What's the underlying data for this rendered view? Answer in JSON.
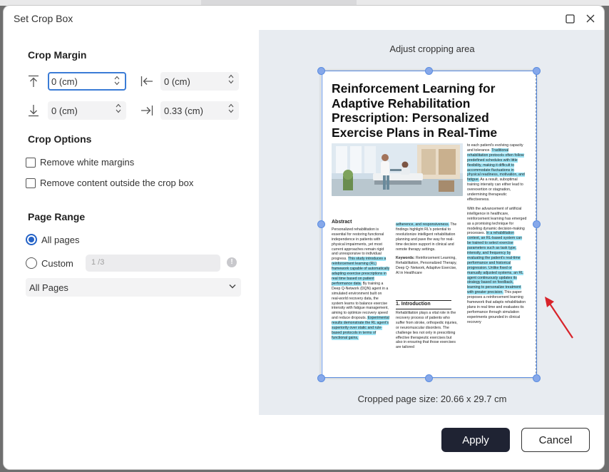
{
  "dialog": {
    "title": "Set Crop Box"
  },
  "crop_margin": {
    "title": "Crop Margin",
    "top_value": "0 (cm)",
    "left_value": "0 (cm)",
    "bottom_value": "0 (cm)",
    "right_value": "0.33 (cm)"
  },
  "crop_options": {
    "title": "Crop Options",
    "remove_white_margins": "Remove white margins",
    "remove_outside": "Remove content outside the crop box"
  },
  "page_range": {
    "title": "Page Range",
    "all_pages": "All pages",
    "custom": "Custom",
    "custom_placeholder": "1 /3",
    "subset_value": "All Pages"
  },
  "preview": {
    "adjust_label": "Adjust cropping area",
    "size_label": "Cropped page size: 20.66 x 29.7 cm"
  },
  "paper": {
    "title": "Reinforcement Learning for Adaptive Rehabilitation Prescription: Personalized Exercise Plans in Real-Time",
    "abstract_heading": "Abstract",
    "abstract_text_a": "Personalized rehabilitation is essential for restoring functional independence in patients with physical impairments, yet most current approaches remain rigid and unresponsive to individual progress.",
    "abstract_hl_a": "This study introduces a reinforcement learning (RL) framework capable of automatically adapting exercise prescriptions in real time based on patient performance data.",
    "abstract_text_b": "By training a Deep Q-Network (DQN) agent in a simulated environment built on real-world recovery data, the system learns to balance exercise intensity with fatigue management, aiming to optimize recovery speed and reduce dropouts.",
    "abstract_hl_b": "Experimental results demonstrate the RL agent's superiority over static and rule-based protocols in terms of functional gains,",
    "mid_hl": "adherence, and responsiveness.",
    "mid_text": "The findings highlight RL's potential to revolutionize intelligent rehabilitation planning and pave the way for real-time decision support in clinical and remote therapy settings.",
    "keywords_label": "Keywords:",
    "keywords_text": "Reinforcement Learning, Rehabilitation, Personalized Therapy, Deep Q- Network, Adaptive Exercise, AI in Healthcare",
    "intro_heading": "1. Introduction",
    "intro_text": "Rehabilitation plays a vital role in the recovery process of patients who suffer from stroke, orthopedic injuries, or neuromuscular disorders. The challenge lies not only in prescribing effective therapeutic exercises but also in ensuring that those exercises are tailored",
    "right_text_a": "to each patient's evolving capacity and tolerance.",
    "right_hl_a": "Traditional rehabilitation protocols often follow predefined schedules with little flexibility, making it difficult to accommodate fluctuations in physical readiness, motivation, and fatigue.",
    "right_text_b": "As a result, suboptimal training intensity can either lead to overexertion or stagnation, undermining therapeutic effectiveness.",
    "right_text_c": "With the advancement of artificial intelligence in healthcare, reinforcement learning has emerged as a promising technique for modeling dynamic decision-making processes.",
    "right_hl_c": "In a rehabilitation context, an RL-based system can be trained to select exercise parameters such as task type, intensity, and frequency by evaluating the patient's real-time performance and historical progression. Unlike fixed or manually adjusted systems, an RL agent continuously updates its strategy based on feedback, learning to personalize treatment with greater precision.",
    "right_text_d": "This paper proposes a reinforcement learning framework that adapts rehabilitation plans in real time and evaluates its performance through simulation experiments grounded in clinical recovery"
  },
  "footer": {
    "apply": "Apply",
    "cancel": "Cancel"
  },
  "colors": {
    "accent": "#2563c7",
    "highlight": "#9fe6f7",
    "apply_bg": "#1f2333",
    "annotation_arrow": "#d8232a"
  }
}
